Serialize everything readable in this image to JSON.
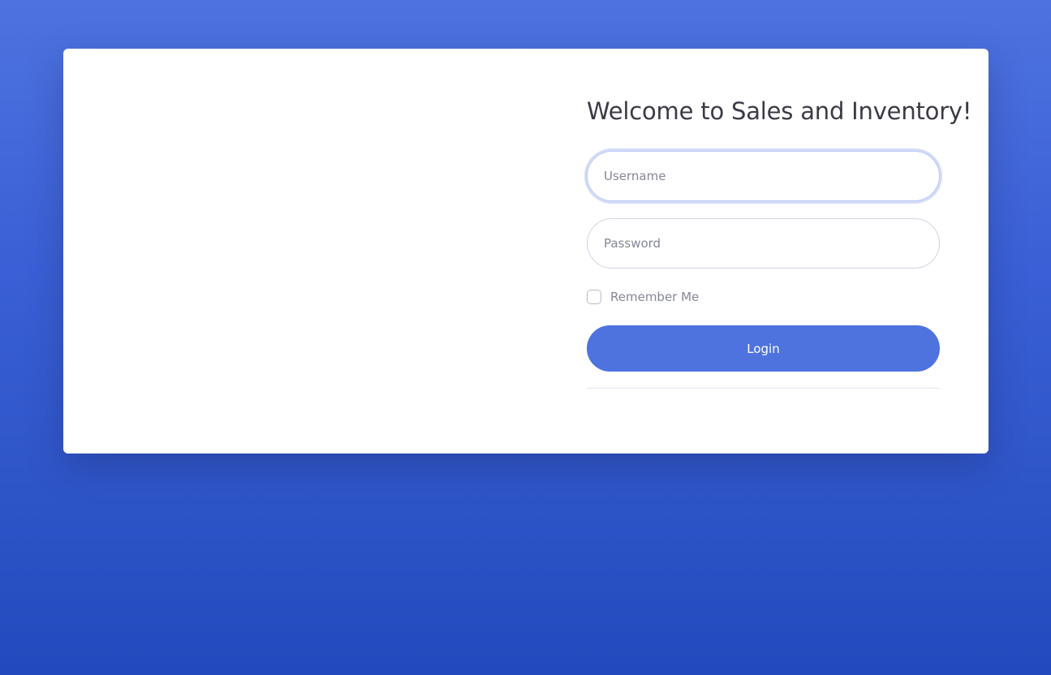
{
  "login": {
    "title": "Welcome to Sales and Inventory!",
    "username_placeholder": "Username",
    "username_value": "",
    "password_placeholder": "Password",
    "password_value": "",
    "remember_label": "Remember Me",
    "remember_checked": false,
    "login_label": "Login"
  },
  "theme": {
    "background_top": "#4e73df",
    "background_bottom": "#224abe",
    "accent": "#4e73df",
    "card": "#ffffff"
  }
}
